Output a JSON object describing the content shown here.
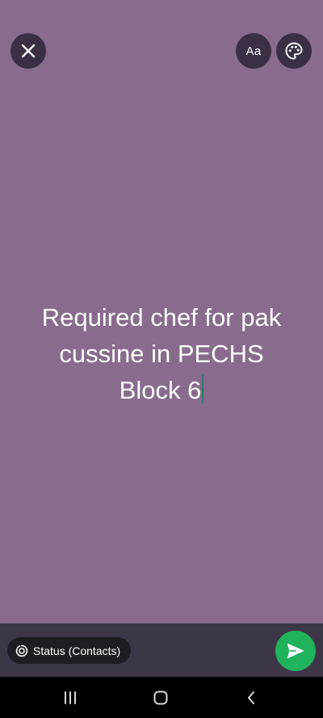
{
  "colors": {
    "background": "#896b8e",
    "button_bg": "#3a2f45",
    "bottom_bar": "#3d3649",
    "pill_bg": "#1f1c24",
    "send_green": "#21b25d",
    "caret": "#2f7a6a",
    "text": "#ffffff"
  },
  "toolbar": {
    "close_icon": "close-icon",
    "font_label": "Aa",
    "palette_icon": "palette-icon"
  },
  "status": {
    "lines": [
      "Required  chef  for pak",
      "cussine in PECHS",
      "Block 6"
    ]
  },
  "bottom": {
    "audience_icon": "status-ring-icon",
    "audience_label": "Status (Contacts)",
    "send_icon": "send-icon"
  },
  "nav": {
    "recents_icon": "recents-icon",
    "home_icon": "home-icon",
    "back_icon": "back-icon"
  }
}
